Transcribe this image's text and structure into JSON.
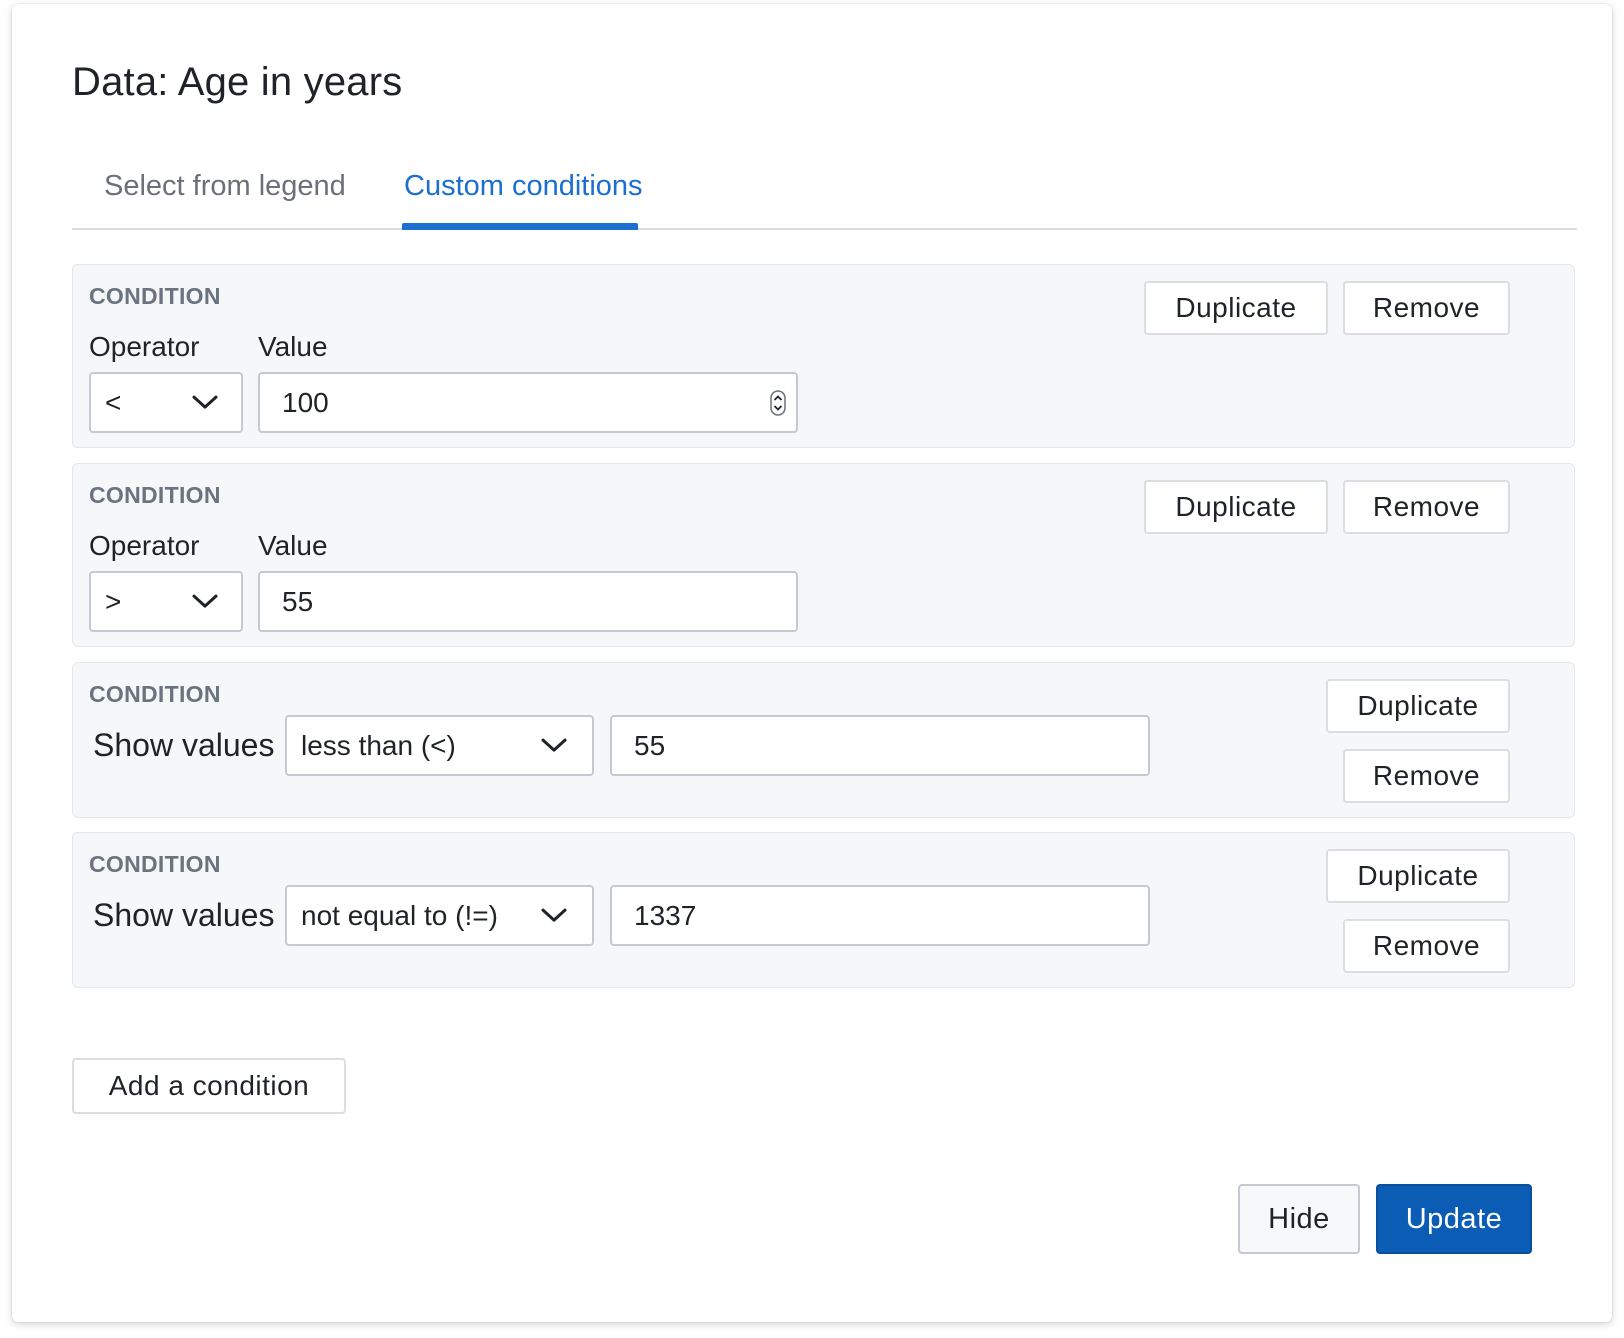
{
  "dialog": {
    "title": "Data: Age in years",
    "tabs": [
      {
        "label": "Select from legend",
        "active": false
      },
      {
        "label": "Custom conditions",
        "active": true
      }
    ],
    "accent_color": "#1a6fd0",
    "primary_button_color": "#0b5cb5"
  },
  "conditions": [
    {
      "heading": "CONDITION",
      "operator_label": "Operator",
      "value_label": "Value",
      "operator": "<",
      "value": "100",
      "duplicate_label": "Duplicate",
      "remove_label": "Remove"
    },
    {
      "heading": "CONDITION",
      "operator_label": "Operator",
      "value_label": "Value",
      "operator": ">",
      "value": "55",
      "duplicate_label": "Duplicate",
      "remove_label": "Remove"
    },
    {
      "heading": "CONDITION",
      "prefix": "Show values",
      "operator": "less than (<)",
      "value": "55",
      "duplicate_label": "Duplicate",
      "remove_label": "Remove"
    },
    {
      "heading": "CONDITION",
      "prefix": "Show values",
      "operator": "not equal to (!=)",
      "value": "1337",
      "duplicate_label": "Duplicate",
      "remove_label": "Remove"
    }
  ],
  "add_condition_label": "Add a condition",
  "footer": {
    "hide_label": "Hide",
    "update_label": "Update"
  }
}
